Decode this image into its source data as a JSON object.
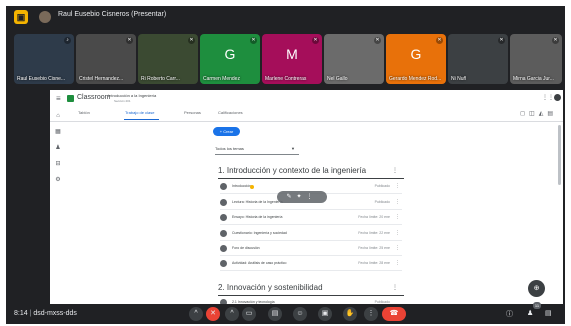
{
  "presentation": {
    "title": "Raul Eusebio Cisneros (Presentar)"
  },
  "participants": [
    {
      "name": "Raul Eusebio Cisne...",
      "letter": "",
      "bg": "#2e3b4a"
    },
    {
      "name": "Cristel Hernandez...",
      "letter": "",
      "bg": "#4a4a4a"
    },
    {
      "name": "Ri Roberto Carr...",
      "letter": "",
      "bg": "#3b4a32"
    },
    {
      "name": "Carmen Mendez",
      "letter": "G",
      "bg": "#1e8e3e"
    },
    {
      "name": "Marlene Contreras",
      "letter": "M",
      "bg": "#a50e5a"
    },
    {
      "name": "Nel Gallo",
      "letter": "",
      "bg": "#6b6b6b"
    },
    {
      "name": "Gerardo Mendez Rod...",
      "letter": "G",
      "bg": "#e8710a"
    },
    {
      "name": "Ni Nuñ",
      "letter": "",
      "bg": "#3c4043"
    },
    {
      "name": "Mirna Garcia Jur...",
      "letter": "",
      "bg": "#5c5c5c"
    }
  ],
  "classroom": {
    "brand": "Classroom",
    "course_line1": "Introducción a la Ingeniería",
    "course_line2": "Sección 201",
    "tabs": [
      "Tablón",
      "Trabajo de clase",
      "Personas",
      "Calificaciones"
    ],
    "create_label": "+ Crear",
    "topic_filter": "Todos los temas",
    "sections": [
      {
        "title": "1. Introducción y contexto de la ingeniería",
        "items": [
          {
            "title": "Introducción",
            "date": "Publicado"
          },
          {
            "title": "Lectura: Historia de la Ingeniería",
            "date": "Publicado"
          },
          {
            "title": "Ensayo: Historia de la ingeniería",
            "date": "Fecha límite: 20 ene"
          },
          {
            "title": "Cuestionario: Ingeniería y sociedad",
            "date": "Fecha límite: 22 ene"
          },
          {
            "title": "Foro de discusión",
            "date": "Fecha límite: 25 ene"
          },
          {
            "title": "Actividad: Análisis de caso práctico",
            "date": "Fecha límite: 28 ene"
          }
        ]
      },
      {
        "title": "2. Innovación y sostenibilidad",
        "items": [
          {
            "title": "2.1 Innovación y tecnología",
            "date": "Publicado"
          }
        ]
      }
    ]
  },
  "bottom": {
    "time": "8:14",
    "meeting_code": "dsd-mxss-dds",
    "participant_count": "11"
  },
  "colors": {
    "meet_bg": "#202124",
    "accent": "#1a73e8",
    "end_red": "#ea4335"
  }
}
